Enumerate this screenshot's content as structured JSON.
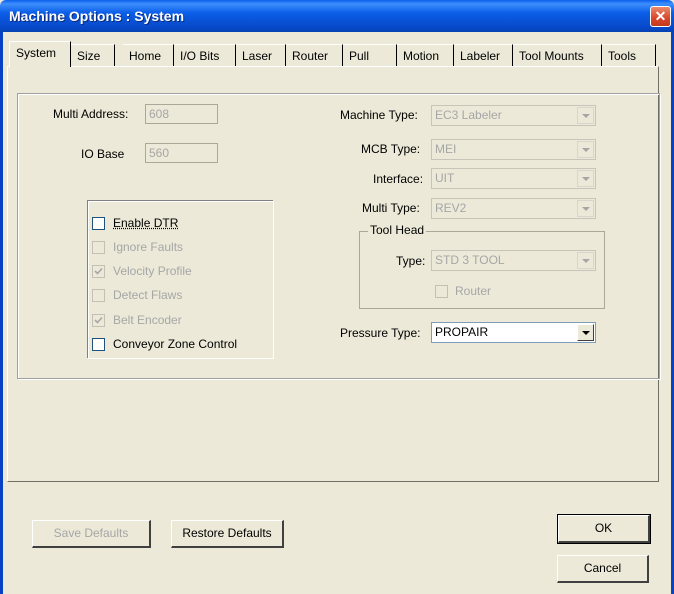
{
  "window": {
    "title": "Machine Options : System",
    "close_glyph": "✕"
  },
  "tabs": [
    {
      "label": "System",
      "active": true
    },
    {
      "label": "Size"
    },
    {
      "label": "Home"
    },
    {
      "label": "I/O Bits"
    },
    {
      "label": "Laser"
    },
    {
      "label": "Router"
    },
    {
      "label": "Pull"
    },
    {
      "label": "Motion"
    },
    {
      "label": "Labeler"
    },
    {
      "label": "Tool Mounts"
    },
    {
      "label": "Tools"
    }
  ],
  "left_fields": {
    "multi_address_label": "Multi Address:",
    "multi_address_value": "608",
    "io_base_label": "IO Base",
    "io_base_value": "560"
  },
  "checkboxes": [
    {
      "label": "Enable DTR",
      "checked": false,
      "enabled": true
    },
    {
      "label": "Ignore  Faults",
      "checked": false,
      "enabled": false
    },
    {
      "label": "Velocity Profile",
      "checked": true,
      "enabled": false
    },
    {
      "label": "Detect Flaws",
      "checked": false,
      "enabled": false
    },
    {
      "label": "Belt Encoder",
      "checked": true,
      "enabled": false
    },
    {
      "label": "Conveyor Zone Control",
      "checked": false,
      "enabled": true
    }
  ],
  "right_fields": {
    "machine_type_label": "Machine Type:",
    "machine_type_value": "EC3 Labeler",
    "mcb_type_label": "MCB Type:",
    "mcb_type_value": "MEI",
    "interface_label": "Interface:",
    "interface_value": "UIT",
    "multi_type_label": "Multi Type:",
    "multi_type_value": "REV2",
    "tool_head_legend": "Tool Head",
    "tool_type_label": "Type:",
    "tool_type_value": "STD 3 TOOL",
    "router_label": "Router",
    "pressure_type_label": "Pressure Type:",
    "pressure_type_value": "PROPAIR"
  },
  "buttons": {
    "save_defaults": "Save Defaults",
    "restore_defaults": "Restore Defaults",
    "ok": "OK",
    "cancel": "Cancel"
  },
  "colors": {
    "titlebar": "#0A5DEB",
    "face": "#ECE9D8",
    "disabled_text": "#A6A6A6",
    "close": "#D7462B"
  }
}
